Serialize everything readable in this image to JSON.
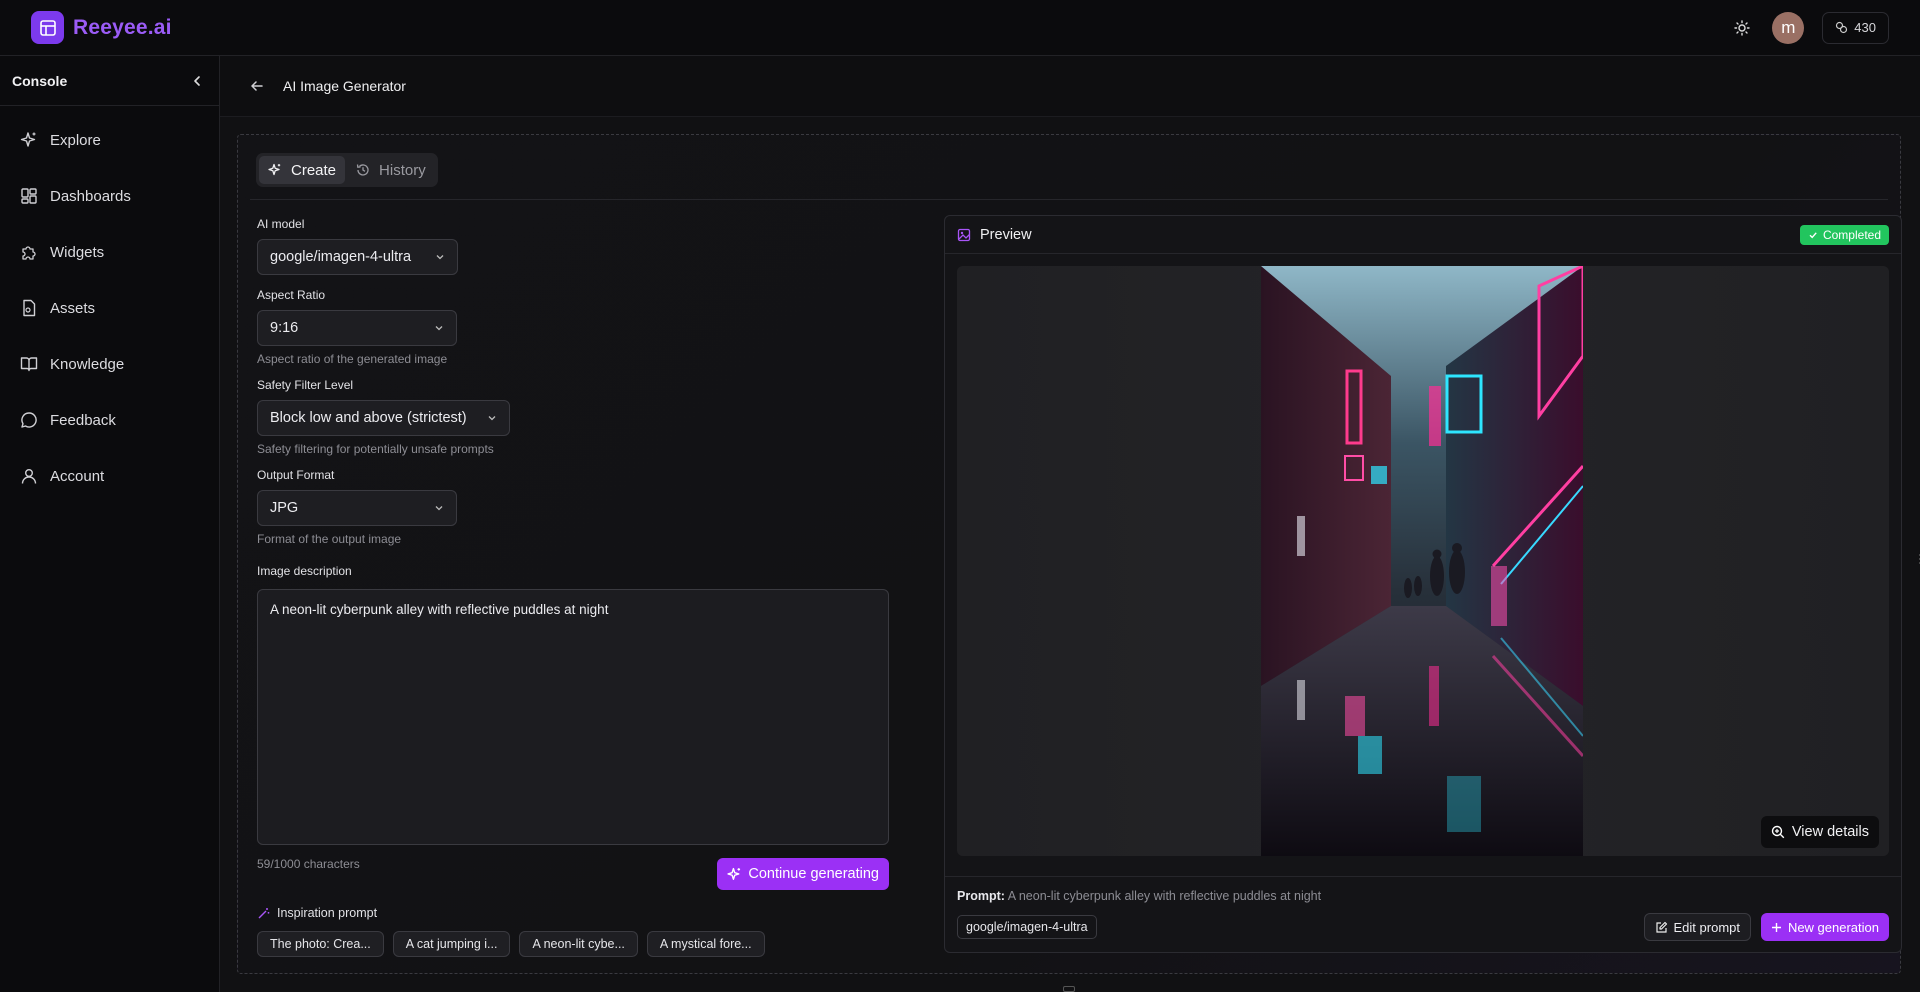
{
  "brand": {
    "name": "Reeyee.ai"
  },
  "header": {
    "avatar_initial": "m",
    "credits": "430"
  },
  "sidebar": {
    "title": "Console",
    "items": [
      {
        "label": "Explore",
        "icon": "sparkles-icon"
      },
      {
        "label": "Dashboards",
        "icon": "grid-icon"
      },
      {
        "label": "Widgets",
        "icon": "puzzle-icon"
      },
      {
        "label": "Assets",
        "icon": "file-icon"
      },
      {
        "label": "Knowledge",
        "icon": "book-icon"
      },
      {
        "label": "Feedback",
        "icon": "chat-icon"
      },
      {
        "label": "Account",
        "icon": "user-icon"
      }
    ]
  },
  "page": {
    "title": "AI Image Generator"
  },
  "tabs": {
    "create": "Create",
    "history": "History"
  },
  "form": {
    "model": {
      "label": "AI model",
      "value": "google/imagen-4-ultra"
    },
    "aspect": {
      "label": "Aspect Ratio",
      "value": "9:16",
      "hint": "Aspect ratio of the generated image"
    },
    "safety": {
      "label": "Safety Filter Level",
      "value": "Block low and above (strictest)",
      "hint": "Safety filtering for potentially unsafe prompts"
    },
    "format": {
      "label": "Output Format",
      "value": "JPG",
      "hint": "Format of the output image"
    },
    "description": {
      "label": "Image description",
      "value": "A neon-lit cyberpunk alley with reflective puddles at night"
    },
    "char_count": "59/1000 characters",
    "generate_label": "Continue generating"
  },
  "inspiration": {
    "label": "Inspiration prompt",
    "chips": [
      "The photo: Crea...",
      "A cat jumping i...",
      "A neon-lit cybe...",
      "A mystical fore..."
    ]
  },
  "preview": {
    "title": "Preview",
    "status": "Completed",
    "status_color": "#22c55e",
    "view_details": "View details",
    "prompt_label": "Prompt:",
    "prompt_text": "A neon-lit cyberpunk alley with reflective puddles at night",
    "model_tag": "google/imagen-4-ultra",
    "edit_label": "Edit prompt",
    "new_label": "New generation"
  },
  "colors": {
    "accent": "#9b30f5",
    "brand": "#7c3aed",
    "success": "#22c55e"
  }
}
